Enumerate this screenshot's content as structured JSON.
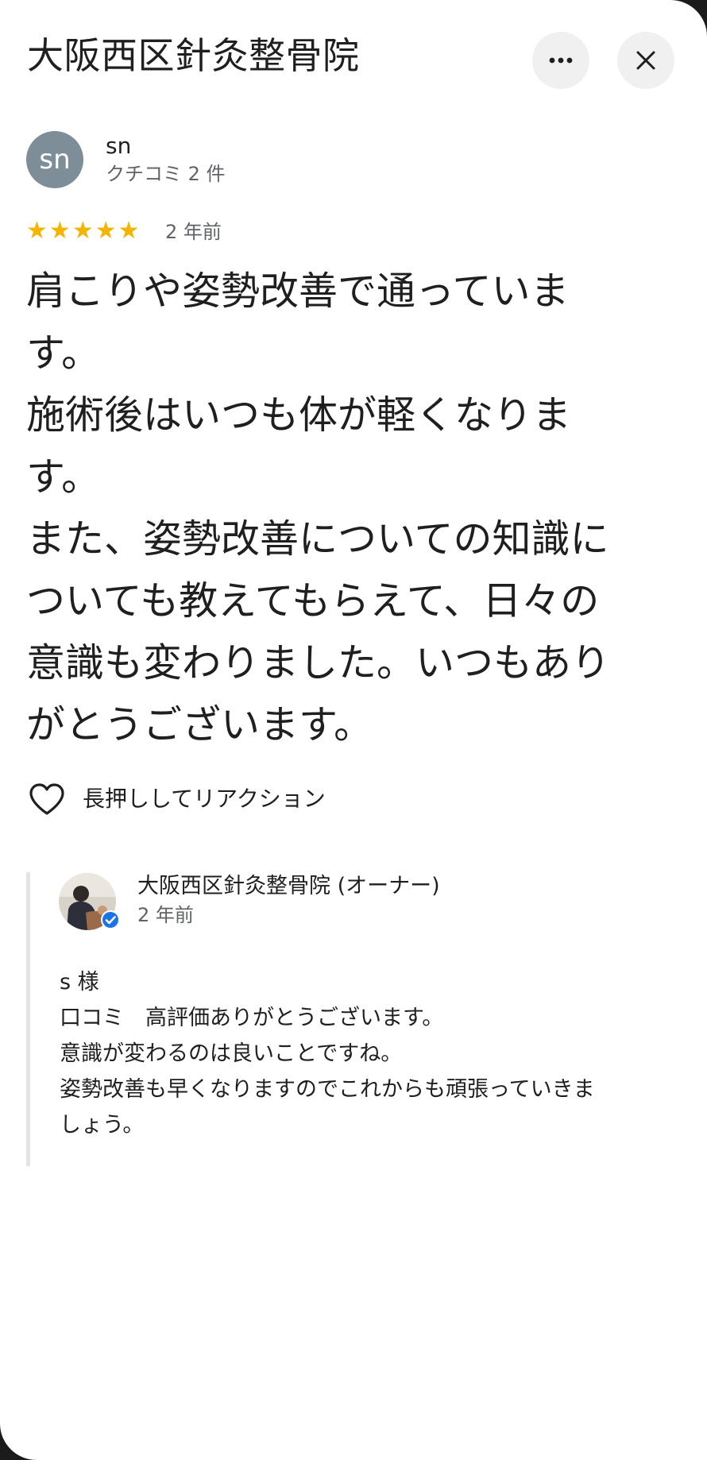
{
  "header": {
    "title": "大阪西区針灸整骨院",
    "more_icon": "more-horiz-icon",
    "close_icon": "close-icon"
  },
  "review": {
    "avatar_text": "sn",
    "avatar_color": "#7d8e99",
    "reviewer_name": "sn",
    "review_count": "クチコミ 2 件",
    "rating": 5,
    "rating_color": "#f4b400",
    "time": "2 年前",
    "text": "肩こりや姿勢改善で通っていま\nす。\n施術後はいつも体が軽くなりま\nす。\nまた、姿勢改善についての知識に\nついても教えてもらえて、日々の\n意識も変わりました。いつもあり\nがとうございます。",
    "reaction_icon": "heart-outline-icon",
    "reaction_label": "長押ししてリアクション"
  },
  "owner_reply": {
    "avatar_icon": "owner-photo-avatar",
    "verified_icon": "verified-badge-icon",
    "name": "大阪西区針灸整骨院 (オーナー)",
    "time": "2 年前",
    "text": "s 様\n口コミ　高評価ありがとうございます。\n意識が変わるのは良いことですね。\n姿勢改善も早くなりますのでこれからも頑張っていきま\nしょう。"
  }
}
